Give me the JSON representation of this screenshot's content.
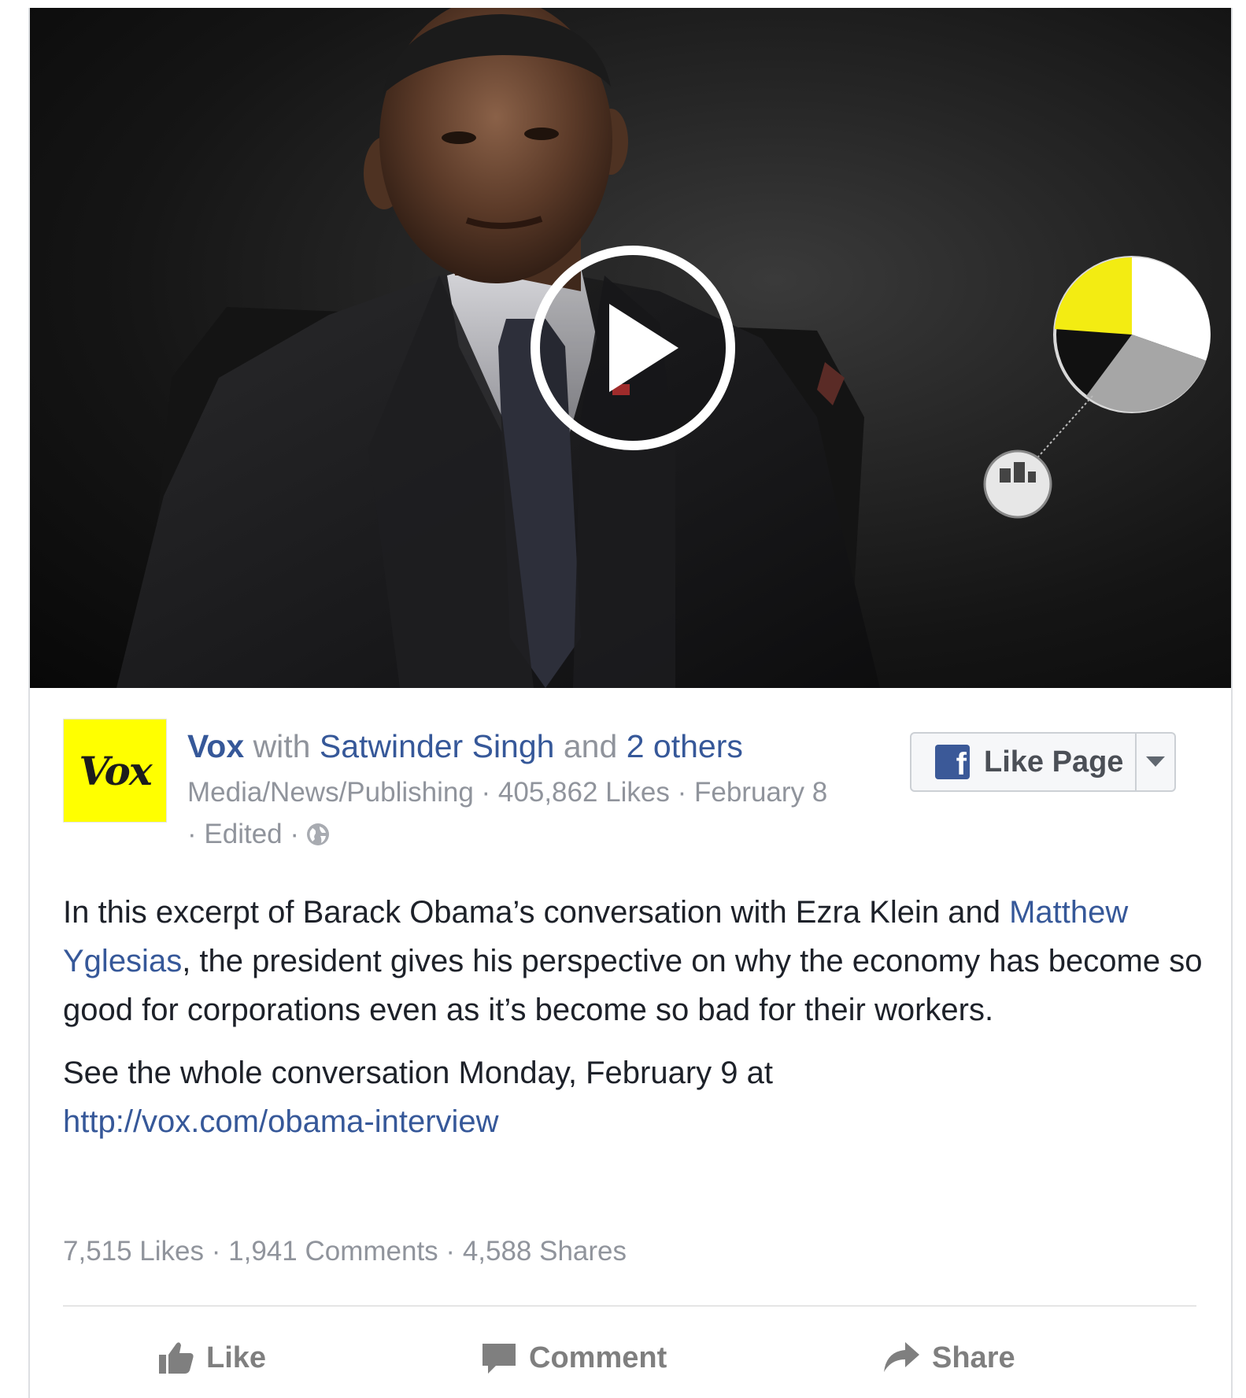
{
  "post": {
    "page_name": "Vox",
    "logo_text": "Vox",
    "with_text": "with",
    "tagged_person": "Satwinder Singh",
    "and_text": "and",
    "others_text": "2 others",
    "category": "Media/News/Publishing",
    "page_likes": "405,862 Likes",
    "date": "February 8",
    "edited": "Edited",
    "separator": "·",
    "like_page_label": "Like Page",
    "fb_logo_letter": "f",
    "text_p1_before": "In this excerpt of Barack Obama’s conversation with Ezra Klein and ",
    "text_p1_link": "Matthew Yglesias",
    "text_p1_after": ", the president gives his perspective on why the economy has become so good for corporations even as it’s become so bad for their workers.",
    "text_p2": "See the whole conversation Monday, February 9 at",
    "text_p2_link": "http://vox.com/obama-interview"
  },
  "stats": {
    "likes": "7,515 Likes",
    "comments": "1,941 Comments",
    "shares": "4,588 Shares"
  },
  "actions": {
    "like": "Like",
    "comment": "Comment",
    "share": "Share"
  },
  "colors": {
    "link": "#365899",
    "muted": "#90949c",
    "text": "#1d2129",
    "facebook_blue": "#3b5998",
    "vox_yellow": "#ffff00"
  },
  "icons": [
    "play-icon",
    "globe-icon",
    "facebook-icon",
    "dropdown-arrow-icon",
    "thumbs-up-icon",
    "comment-icon",
    "share-arrow-icon"
  ]
}
